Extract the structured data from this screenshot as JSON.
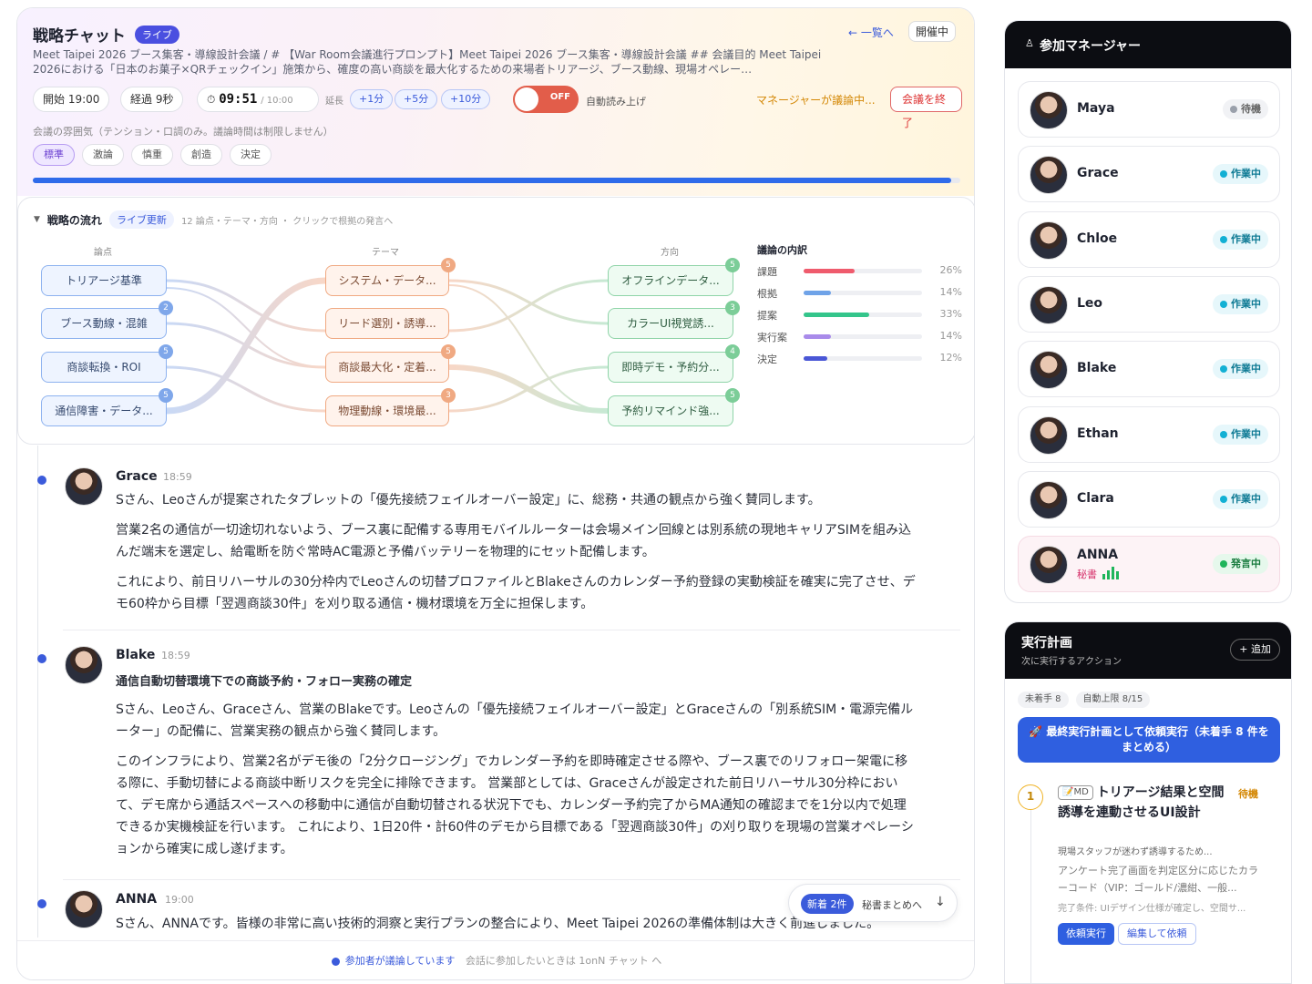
{
  "header": {
    "title": "戦略チャット",
    "live_badge": "ライブ",
    "back_link": "← 一覧へ",
    "status": "開催中",
    "subtitle": "Meet Taipei 2026 ブース集客・導線設計会議 / # 【War Room会議進行プロンプト】Meet Taipei 2026 ブース集客・導線設計会議 ## 会議目的 Meet Taipei 2026における「日本のお菓子×QRチェックイン」施策から、確度の高い商談を最大化するための来場者トリアージ、ブース動線、現場オペレー…"
  },
  "controls": {
    "start": "開始 19:00",
    "elapsed": "経過 9秒",
    "timer": "09:51",
    "timer_limit": "/ 10:00",
    "extend_label": "延長",
    "extend_buttons": [
      "+1分",
      "+5分",
      "+10分"
    ],
    "toggle_state": "OFF",
    "auto_read": "自動読み上げ",
    "manager_discussing": "マネージャーが議論中...",
    "end_button": "会議を終了"
  },
  "mood": {
    "label": "会議の雰囲気（テンション・口調のみ。議論時間は制限しません）",
    "options": [
      "標準",
      "激論",
      "慎重",
      "創造",
      "決定"
    ],
    "selected": "標準"
  },
  "progress": {
    "fraction": 0.99
  },
  "flow": {
    "title": "戦略の流れ",
    "live": "ライブ更新",
    "desc": "12 論点・テーマ・方向 ・ クリックで根拠の発言へ",
    "col_heads": [
      "論点",
      "テーマ",
      "方向"
    ],
    "col1": [
      {
        "label": "トリアージ基準",
        "badge": ""
      },
      {
        "label": "ブース動線・混雑",
        "badge": "2"
      },
      {
        "label": "商談転換・ROI",
        "badge": "5"
      },
      {
        "label": "通信障害・データ...",
        "badge": "5"
      }
    ],
    "col2": [
      {
        "label": "システム・データ...",
        "badge": "5"
      },
      {
        "label": "リード選別・誘導...",
        "badge": ""
      },
      {
        "label": "商談最大化・定着...",
        "badge": "5"
      },
      {
        "label": "物理動線・環境最...",
        "badge": "3"
      }
    ],
    "col3": [
      {
        "label": "オフラインデータ...",
        "badge": "5"
      },
      {
        "label": "カラーUI視覚誘...",
        "badge": "3"
      },
      {
        "label": "即時デモ・予約分...",
        "badge": "4"
      },
      {
        "label": "予約リマインド強...",
        "badge": "5"
      }
    ],
    "breakdown": {
      "title": "議論の内訳",
      "items": [
        {
          "name": "課題",
          "pct": "26%",
          "value": 0.26,
          "color": "#ef5b6d"
        },
        {
          "name": "根拠",
          "pct": "14%",
          "value": 0.14,
          "color": "#6fa3e8"
        },
        {
          "name": "提案",
          "pct": "33%",
          "value": 0.33,
          "color": "#34c58b"
        },
        {
          "name": "実行案",
          "pct": "14%",
          "value": 0.14,
          "color": "#a98bea"
        },
        {
          "name": "決定",
          "pct": "12%",
          "value": 0.12,
          "color": "#4a57d6"
        }
      ]
    }
  },
  "messages": [
    {
      "name": "Grace",
      "time": "18:59",
      "heading": "",
      "paragraphs": [
        "Sさん、Leoさんが提案されたタブレットの「優先接続フェイルオーバー設定」に、総務・共通の観点から強く賛同します。",
        "営業2名の通信が一切途切れないよう、ブース裏に配備する専用モバイルルーターは会場メイン回線とは別系統の現地キャリアSIMを組み込んだ端末を選定し、給電断を防ぐ常時AC電源と予備バッテリーを物理的にセット配備します。",
        "これにより、前日リハーサルの30分枠内でLeoさんの切替プロファイルとBlakeさんのカレンダー予約登録の実動検証を確実に完了させ、デモ60枠から目標「翌週商談30件」を刈り取る通信・機材環境を万全に担保します。"
      ]
    },
    {
      "name": "Blake",
      "time": "18:59",
      "heading": "通信自動切替環境下での商談予約・フォロー実務の確定",
      "paragraphs": [
        "Sさん、Leoさん、Graceさん、営業のBlakeです。Leoさんの「優先接続フェイルオーバー設定」とGraceさんの「別系統SIM・電源完備ルーター」の配備に、営業実務の観点から強く賛同します。",
        "このインフラにより、営業2名がデモ後の「2分クロージング」でカレンダー予約を即時確定させる際や、ブース裏でのリフォロー架電に移る際に、手動切替による商談中断リスクを完全に排除できます。 営業部としては、Graceさんが設定された前日リハーサル30分枠において、デモ席から通話スペースへの移動中に通信が自動切替される状況下でも、カレンダー予約完了からMA通知の確認までを1分以内で処理できるか実機検証を行います。 これにより、1日20件・計60件のデモから目標である「翌週商談30件」の刈り取りを現場の営業オペレーションから確実に成し遂げます。"
      ]
    },
    {
      "name": "ANNA",
      "time": "19:00",
      "heading": "",
      "paragraphs": [
        "Sさん、ANNAです。皆様の非常に高い技術的洞察と実行プランの整合により、Meet Taipei 2026の準備体制は大きく前進しました。"
      ]
    }
  ],
  "new_pill": {
    "badge": "新着 2件",
    "text": "秘書まとめへ",
    "arrow": "↓"
  },
  "footer": {
    "active": "参加者が議論しています",
    "hint": "会話に参加したいときは 1onN チャット へ"
  },
  "managers": {
    "title": "参加マネージャー",
    "items": [
      {
        "name": "Maya",
        "status": "待機",
        "kind": "wait"
      },
      {
        "name": "Grace",
        "status": "作業中",
        "kind": "work"
      },
      {
        "name": "Chloe",
        "status": "作業中",
        "kind": "work"
      },
      {
        "name": "Leo",
        "status": "作業中",
        "kind": "work"
      },
      {
        "name": "Blake",
        "status": "作業中",
        "kind": "work"
      },
      {
        "name": "Ethan",
        "status": "作業中",
        "kind": "work"
      },
      {
        "name": "Clara",
        "status": "作業中",
        "kind": "work"
      },
      {
        "name": "ANNA",
        "status": "発言中",
        "kind": "speak",
        "role": "秘書"
      }
    ]
  },
  "plan": {
    "title": "実行計画",
    "subtitle": "次に実行するアクション",
    "add": "+ 追加",
    "chips": [
      "未着手 8",
      "自動上限 8/15"
    ],
    "big_button": "🚀 最終実行計画として依頼実行（未着手 8 件をまとめる）",
    "task": {
      "num": "1",
      "tag": "MD",
      "title": "トリアージ結果と空間誘導を連動させるUI設計",
      "status": "待機",
      "desc": "現場スタッフが迷わず誘導するため...",
      "body": "アンケート完了画面を判定区分に応じたカラーコード（VIP：ゴールド/濃紺、一般...",
      "cond": "完了条件: UIデザイン仕様が確定し、空間サ...",
      "run": "依頼実行",
      "edit": "編集して依頼"
    }
  }
}
